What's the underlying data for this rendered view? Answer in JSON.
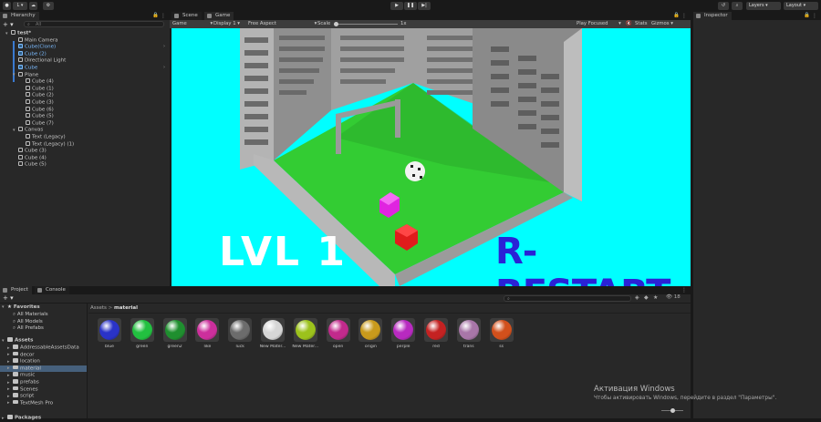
{
  "topbar": {
    "account_label": "L",
    "layers_label": "Layers",
    "layout_label": "Layout"
  },
  "hierarchy": {
    "tab_label": "Hierarchy",
    "search_placeholder": "All",
    "rows": [
      {
        "label": "test*",
        "indent": 0,
        "kind": "scene"
      },
      {
        "label": "Main Camera",
        "indent": 1,
        "kind": "obj"
      },
      {
        "label": "Cube(Clone)",
        "indent": 1,
        "kind": "blue"
      },
      {
        "label": "Cube (2)",
        "indent": 1,
        "kind": "blue"
      },
      {
        "label": "Directional Light",
        "indent": 1,
        "kind": "obj"
      },
      {
        "label": "Cube",
        "indent": 1,
        "kind": "blue"
      },
      {
        "label": "Plane",
        "indent": 1,
        "kind": "parent"
      },
      {
        "label": "Cube (4)",
        "indent": 2,
        "kind": "obj"
      },
      {
        "label": "Cube (1)",
        "indent": 2,
        "kind": "obj"
      },
      {
        "label": "Cube (2)",
        "indent": 2,
        "kind": "obj"
      },
      {
        "label": "Cube (3)",
        "indent": 2,
        "kind": "obj"
      },
      {
        "label": "Cube (6)",
        "indent": 2,
        "kind": "obj"
      },
      {
        "label": "Cube (5)",
        "indent": 2,
        "kind": "obj"
      },
      {
        "label": "Cube (7)",
        "indent": 2,
        "kind": "obj"
      },
      {
        "label": "Canvas",
        "indent": 1,
        "kind": "parent"
      },
      {
        "label": "Text (Legacy)",
        "indent": 2,
        "kind": "obj"
      },
      {
        "label": "Text (Legacy) (1)",
        "indent": 2,
        "kind": "obj"
      },
      {
        "label": "Cube (3)",
        "indent": 1,
        "kind": "obj"
      },
      {
        "label": "Cube (4)",
        "indent": 1,
        "kind": "obj"
      },
      {
        "label": "Cube (5)",
        "indent": 1,
        "kind": "obj"
      }
    ]
  },
  "view_tabs": {
    "scene": "Scene",
    "game": "Game"
  },
  "game_toolbar": {
    "game": "Game",
    "display": "Display 1",
    "aspect": "Free Aspect",
    "scale_label": "Scale",
    "scale_value": "1x",
    "play_focused": "Play Focused",
    "stats": "Stats",
    "gizmos": "Gizmos"
  },
  "game_view": {
    "level_text": "LVL 1",
    "restart_text": "R-RESTART",
    "sky_color": "#00ffff",
    "grass_color": "#33cc33"
  },
  "inspector": {
    "tab_label": "Inspector"
  },
  "project": {
    "tab_project": "Project",
    "tab_console": "Console",
    "breadcrumb_root": "Assets",
    "breadcrumb_sep": ">",
    "breadcrumb_current": "material",
    "hidden_count": "18",
    "favorites": {
      "label": "Favorites",
      "items": [
        "All Materials",
        "All Models",
        "All Prefabs"
      ]
    },
    "assets_label": "Assets",
    "folders": [
      "AddressableAssetsData",
      "decor",
      "location",
      "material",
      "music",
      "prefabs",
      "Scenes",
      "script",
      "TextMesh Pro"
    ],
    "packages_label": "Packages",
    "materials": [
      {
        "name": "blue",
        "color": "#2a33c8"
      },
      {
        "name": "green",
        "color": "#22c040"
      },
      {
        "name": "green2",
        "color": "#1f8f2f"
      },
      {
        "name": "like",
        "color": "#cc2f9c"
      },
      {
        "name": "luck",
        "color": "#6c6c6c"
      },
      {
        "name": "New Mater...",
        "color": "#d6d6d6"
      },
      {
        "name": "New Mater...",
        "color": "#9cc21c"
      },
      {
        "name": "open",
        "color": "#c22a8c"
      },
      {
        "name": "origin",
        "color": "#c99a1c"
      },
      {
        "name": "perple",
        "color": "#b82ac0"
      },
      {
        "name": "red",
        "color": "#c42222"
      },
      {
        "name": "trans",
        "color": "#a876a8"
      },
      {
        "name": "ss",
        "color": "#d2501c"
      }
    ]
  },
  "watermark": {
    "line1": "Активация Windows",
    "line2": "Чтобы активировать Windows, перейдите в раздел \"Параметры\"."
  }
}
